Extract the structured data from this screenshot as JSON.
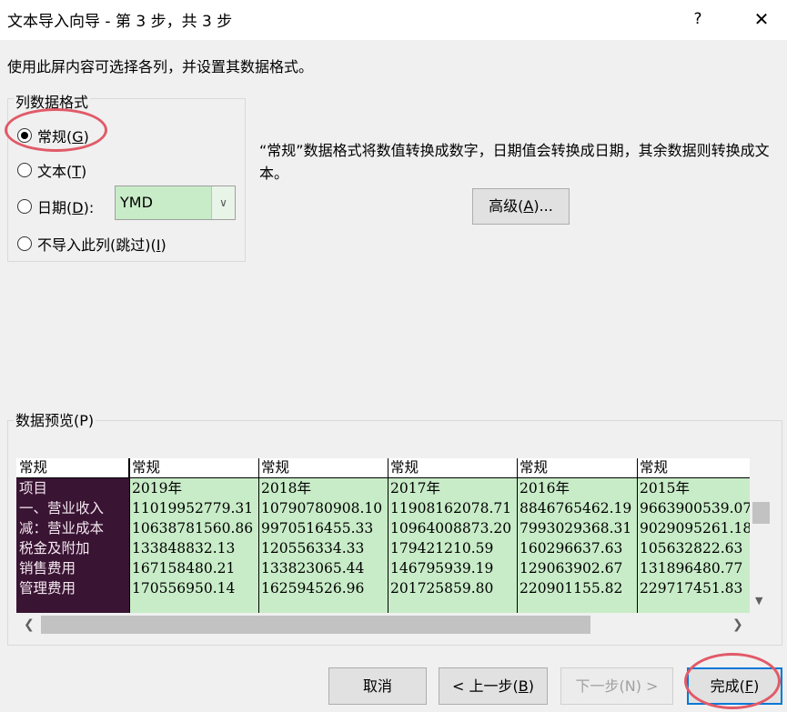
{
  "window": {
    "title": "文本导入向导 - 第 3 步，共 3 步",
    "help_label": "?",
    "close_label": "✕"
  },
  "instruction": "使用此屏内容可选择各列，并设置其数据格式。",
  "column_format": {
    "legend": "列数据格式",
    "selected": "general",
    "options": {
      "general": {
        "text": "常规(",
        "key": "G",
        "suffix": ")"
      },
      "text": {
        "text": "文本(",
        "key": "T",
        "suffix": ")"
      },
      "date": {
        "text": "日期(",
        "key": "D",
        "suffix": "):"
      },
      "skip": {
        "text": "不导入此列(跳过)(",
        "key": "I",
        "suffix": ")"
      }
    },
    "date_format_value": "YMD",
    "date_dropdown_icon": "chevron-down-icon"
  },
  "description": "“常规”数据格式将数值转换成数字，日期值会转换成日期，其余数据则转换成文本。",
  "advanced_button": {
    "text": "高级(",
    "key": "A",
    "suffix": ")..."
  },
  "preview": {
    "legend": "数据预览(P)",
    "headers": [
      "常规",
      "常规",
      "常规",
      "常规",
      "常规",
      "常规"
    ],
    "rows": [
      [
        "项目",
        "2019年",
        "2018年",
        "2017年",
        "2016年",
        "2015年"
      ],
      [
        "一、营业收入",
        "11019952779.31",
        "10790780908.10",
        "11908162078.71",
        "8846765462.19",
        "9663900539.07"
      ],
      [
        "减：营业成本",
        "10638781560.86",
        "9970516455.33",
        "10964008873.20",
        "7993029368.31",
        "9029095261.18"
      ],
      [
        "税金及附加",
        "133848832.13",
        "120556334.33",
        "179421210.59",
        "160296637.63",
        "105632822.63"
      ],
      [
        "销售费用",
        "167158480.21",
        "133823065.44",
        "146795939.19",
        "129063902.67",
        "131896480.77"
      ],
      [
        "管理费用",
        "170556950.14",
        "162594526.96",
        "201725859.80",
        "220901155.82",
        "229717451.83"
      ]
    ]
  },
  "buttons": {
    "cancel": "取消",
    "back": {
      "text": "< 上一步(",
      "key": "B",
      "suffix": ")"
    },
    "next": "下一步(N) >",
    "finish": {
      "text": "完成(",
      "key": "F",
      "suffix": ")"
    }
  },
  "annotation_color": "#e05a68",
  "selected_cell_color": "#c8ebc8",
  "first_column_color": "#3a1433"
}
